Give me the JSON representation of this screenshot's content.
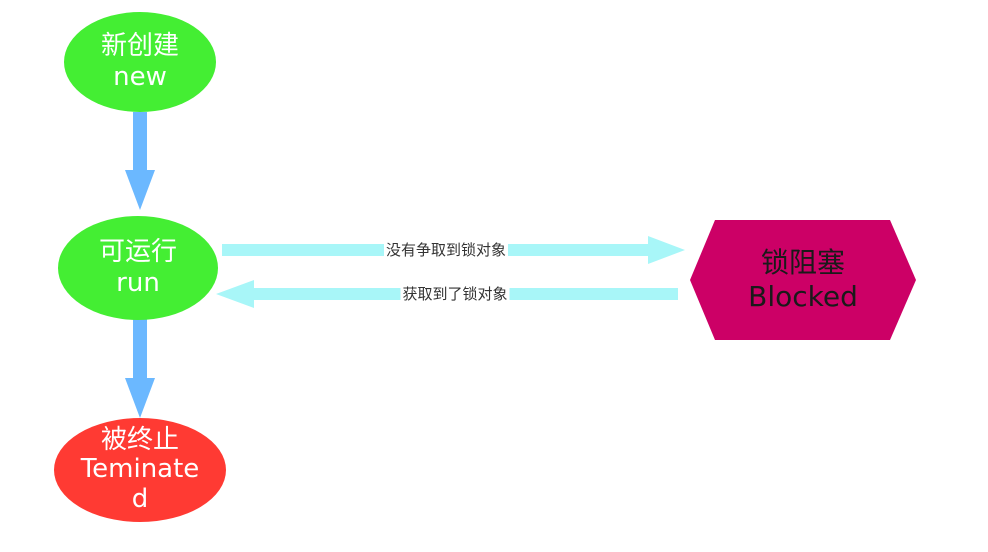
{
  "colors": {
    "new_fill": "#44ee33",
    "run_fill": "#44ee33",
    "terminated_fill": "#ff3a33",
    "blocked_fill": "#cc0066",
    "vertical_arrow": "#6bb8ff",
    "horizontal_arrow": "#a8f6f8",
    "white_text": "#ffffff",
    "blocked_text": "#1a1a1a",
    "edge_text": "#333333"
  },
  "nodes": {
    "new": {
      "shape": "ellipse",
      "cn": "新创建",
      "en": "new"
    },
    "run": {
      "shape": "ellipse",
      "cn": "可运行",
      "en": "run"
    },
    "terminated": {
      "shape": "ellipse",
      "cn": "被终止",
      "en_line1": "Teminate",
      "en_line2": "d"
    },
    "blocked": {
      "shape": "hexagon",
      "cn": "锁阻塞",
      "en": "Blocked"
    }
  },
  "edges": {
    "run_to_blocked": "没有争取到锁对象",
    "blocked_to_run": "获取到了锁对象"
  }
}
